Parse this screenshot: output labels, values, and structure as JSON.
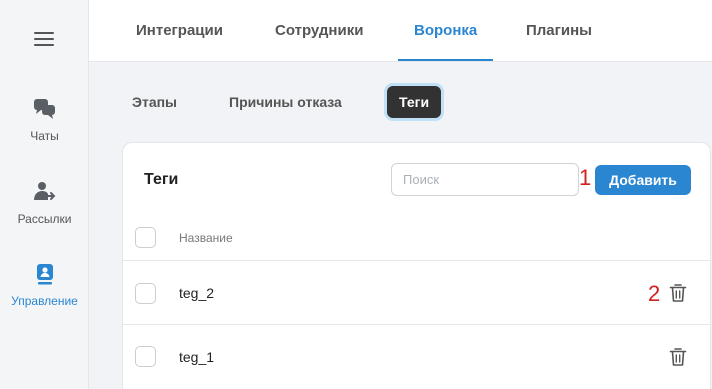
{
  "sidebar": {
    "menu_icon": "hamburger-icon",
    "items": [
      {
        "label": "Чаты",
        "icon": "chat-bubbles-icon",
        "active": false
      },
      {
        "label": "Рассылки",
        "icon": "user-send-icon",
        "active": false
      },
      {
        "label": "Управление",
        "icon": "management-badge-icon",
        "active": true
      }
    ]
  },
  "top_tabs": [
    {
      "label": "Интеграции",
      "active": false
    },
    {
      "label": "Сотрудники",
      "active": false
    },
    {
      "label": "Воронка",
      "active": true
    },
    {
      "label": "Плагины",
      "active": false
    }
  ],
  "sub_tabs": [
    {
      "label": "Этапы",
      "active": false
    },
    {
      "label": "Причины отказа",
      "active": false
    },
    {
      "label": "Теги",
      "active": true
    }
  ],
  "card": {
    "title": "Теги",
    "search_placeholder": "Поиск",
    "search_value": "",
    "add_label": "Добавить",
    "column_header": "Название",
    "rows": [
      {
        "name": "teg_2"
      },
      {
        "name": "teg_1"
      }
    ]
  },
  "annotations": {
    "marker_1": "1",
    "marker_2": "2"
  },
  "colors": {
    "accent": "#2a86d1",
    "active_tab_bg": "#323232",
    "annotation": "#d21f1f"
  }
}
